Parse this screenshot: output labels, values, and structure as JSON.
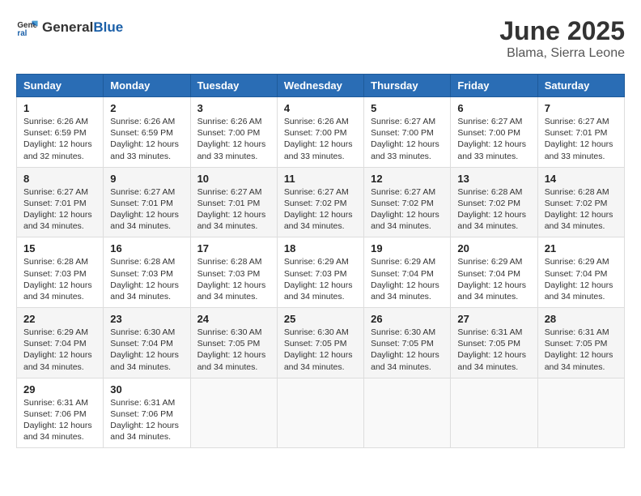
{
  "header": {
    "logo_general": "General",
    "logo_blue": "Blue",
    "month_year": "June 2025",
    "location": "Blama, Sierra Leone"
  },
  "weekdays": [
    "Sunday",
    "Monday",
    "Tuesday",
    "Wednesday",
    "Thursday",
    "Friday",
    "Saturday"
  ],
  "weeks": [
    [
      {
        "day": "1",
        "sunrise": "6:26 AM",
        "sunset": "6:59 PM",
        "daylight": "12 hours and 32 minutes."
      },
      {
        "day": "2",
        "sunrise": "6:26 AM",
        "sunset": "6:59 PM",
        "daylight": "12 hours and 33 minutes."
      },
      {
        "day": "3",
        "sunrise": "6:26 AM",
        "sunset": "7:00 PM",
        "daylight": "12 hours and 33 minutes."
      },
      {
        "day": "4",
        "sunrise": "6:26 AM",
        "sunset": "7:00 PM",
        "daylight": "12 hours and 33 minutes."
      },
      {
        "day": "5",
        "sunrise": "6:27 AM",
        "sunset": "7:00 PM",
        "daylight": "12 hours and 33 minutes."
      },
      {
        "day": "6",
        "sunrise": "6:27 AM",
        "sunset": "7:00 PM",
        "daylight": "12 hours and 33 minutes."
      },
      {
        "day": "7",
        "sunrise": "6:27 AM",
        "sunset": "7:01 PM",
        "daylight": "12 hours and 33 minutes."
      }
    ],
    [
      {
        "day": "8",
        "sunrise": "6:27 AM",
        "sunset": "7:01 PM",
        "daylight": "12 hours and 34 minutes."
      },
      {
        "day": "9",
        "sunrise": "6:27 AM",
        "sunset": "7:01 PM",
        "daylight": "12 hours and 34 minutes."
      },
      {
        "day": "10",
        "sunrise": "6:27 AM",
        "sunset": "7:01 PM",
        "daylight": "12 hours and 34 minutes."
      },
      {
        "day": "11",
        "sunrise": "6:27 AM",
        "sunset": "7:02 PM",
        "daylight": "12 hours and 34 minutes."
      },
      {
        "day": "12",
        "sunrise": "6:27 AM",
        "sunset": "7:02 PM",
        "daylight": "12 hours and 34 minutes."
      },
      {
        "day": "13",
        "sunrise": "6:28 AM",
        "sunset": "7:02 PM",
        "daylight": "12 hours and 34 minutes."
      },
      {
        "day": "14",
        "sunrise": "6:28 AM",
        "sunset": "7:02 PM",
        "daylight": "12 hours and 34 minutes."
      }
    ],
    [
      {
        "day": "15",
        "sunrise": "6:28 AM",
        "sunset": "7:03 PM",
        "daylight": "12 hours and 34 minutes."
      },
      {
        "day": "16",
        "sunrise": "6:28 AM",
        "sunset": "7:03 PM",
        "daylight": "12 hours and 34 minutes."
      },
      {
        "day": "17",
        "sunrise": "6:28 AM",
        "sunset": "7:03 PM",
        "daylight": "12 hours and 34 minutes."
      },
      {
        "day": "18",
        "sunrise": "6:29 AM",
        "sunset": "7:03 PM",
        "daylight": "12 hours and 34 minutes."
      },
      {
        "day": "19",
        "sunrise": "6:29 AM",
        "sunset": "7:04 PM",
        "daylight": "12 hours and 34 minutes."
      },
      {
        "day": "20",
        "sunrise": "6:29 AM",
        "sunset": "7:04 PM",
        "daylight": "12 hours and 34 minutes."
      },
      {
        "day": "21",
        "sunrise": "6:29 AM",
        "sunset": "7:04 PM",
        "daylight": "12 hours and 34 minutes."
      }
    ],
    [
      {
        "day": "22",
        "sunrise": "6:29 AM",
        "sunset": "7:04 PM",
        "daylight": "12 hours and 34 minutes."
      },
      {
        "day": "23",
        "sunrise": "6:30 AM",
        "sunset": "7:04 PM",
        "daylight": "12 hours and 34 minutes."
      },
      {
        "day": "24",
        "sunrise": "6:30 AM",
        "sunset": "7:05 PM",
        "daylight": "12 hours and 34 minutes."
      },
      {
        "day": "25",
        "sunrise": "6:30 AM",
        "sunset": "7:05 PM",
        "daylight": "12 hours and 34 minutes."
      },
      {
        "day": "26",
        "sunrise": "6:30 AM",
        "sunset": "7:05 PM",
        "daylight": "12 hours and 34 minutes."
      },
      {
        "day": "27",
        "sunrise": "6:31 AM",
        "sunset": "7:05 PM",
        "daylight": "12 hours and 34 minutes."
      },
      {
        "day": "28",
        "sunrise": "6:31 AM",
        "sunset": "7:05 PM",
        "daylight": "12 hours and 34 minutes."
      }
    ],
    [
      {
        "day": "29",
        "sunrise": "6:31 AM",
        "sunset": "7:06 PM",
        "daylight": "12 hours and 34 minutes."
      },
      {
        "day": "30",
        "sunrise": "6:31 AM",
        "sunset": "7:06 PM",
        "daylight": "12 hours and 34 minutes."
      },
      null,
      null,
      null,
      null,
      null
    ]
  ]
}
